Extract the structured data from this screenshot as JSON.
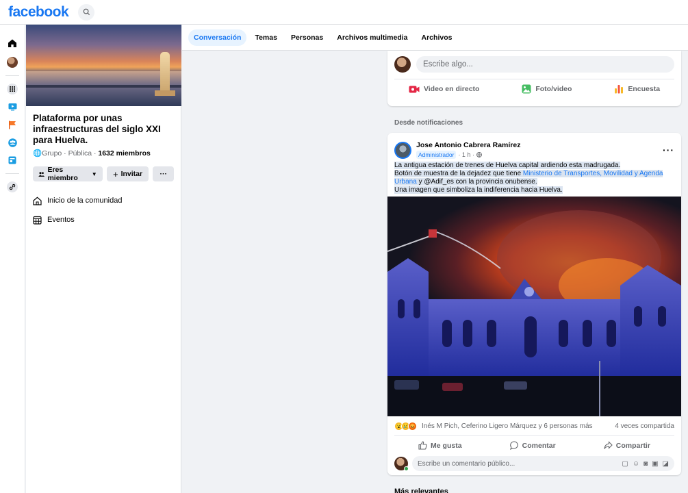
{
  "brand": {
    "logo": "facebook",
    "color": "#1877f2"
  },
  "group": {
    "title": "Plataforma por unas infraestructuras del siglo XXI para Huelva.",
    "meta_prefix": "Grupo · Pública · ",
    "members": "1632 miembros",
    "member_button": "Eres miembro",
    "invite_button": "Invitar",
    "more_button": "···"
  },
  "sidebar_nav": [
    {
      "label": "Inicio de la comunidad",
      "icon": "home-outline-icon"
    },
    {
      "label": "Eventos",
      "icon": "calendar-grid-icon"
    }
  ],
  "tabs": [
    {
      "label": "Conversación",
      "active": true
    },
    {
      "label": "Temas",
      "active": false
    },
    {
      "label": "Personas",
      "active": false
    },
    {
      "label": "Archivos multimedia",
      "active": false
    },
    {
      "label": "Archivos",
      "active": false
    }
  ],
  "composer": {
    "placeholder": "Escribe algo...",
    "actions": [
      {
        "label": "Video en directo",
        "icon": "live-video-icon"
      },
      {
        "label": "Foto/video",
        "icon": "photo-icon"
      },
      {
        "label": "Encuesta",
        "icon": "poll-icon"
      }
    ]
  },
  "feed_section": "Desde notificaciones",
  "post": {
    "author": "Jose Antonio Cabrera Ramírez",
    "badge": "Administrador",
    "time": "· 1 h ·",
    "text": {
      "line1": "La antigua estación de trenes de Huelva capital ardiendo esta madrugada.",
      "line2_pre": "Botón de muestra de la dejadez que tiene ",
      "link": "Ministerio de Transportes, Movilidad y Agenda Urbana",
      "line2_post": " y @Adif_es  con la provincia onubense.",
      "line3": "Una imagen que simboliza la indiferencia hacia  Huelva."
    },
    "reactions_text": "Inés M Pich, Ceferino Ligero Márquez y 6 personas más",
    "shares": "4 veces compartida",
    "actions": {
      "like": "Me gusta",
      "comment": "Comentar",
      "share": "Compartir"
    },
    "comment_placeholder": "Escribe un comentario público..."
  },
  "more_relevant": "Más relevantes"
}
